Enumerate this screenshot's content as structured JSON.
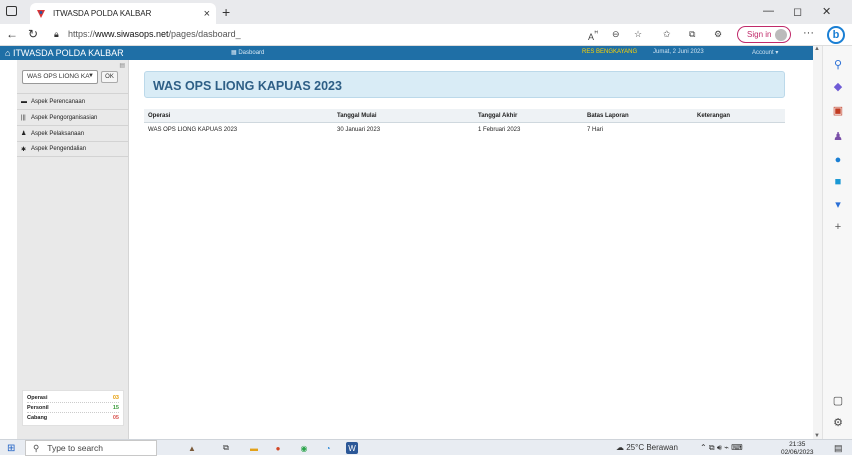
{
  "browser": {
    "tab_title": "ITWASDA POLDA KALBAR",
    "tab_close": "×",
    "new_tab": "+",
    "url_prefix": "https://",
    "url_host": "www.siwasops.net",
    "url_path": "/pages/dasboard_",
    "sign_in": "Sign in",
    "more": "···",
    "win_min": "—",
    "win_max": "◻",
    "win_close": "✕"
  },
  "navbar": {
    "brand": "ITWASDA POLDA KALBAR",
    "dashboard": "Dasboard",
    "user": "RES BENGKAYANG",
    "date": "Jumat, 2 Juni 2023",
    "account": "Account"
  },
  "sidebar": {
    "select_value": "WAS OPS LIONG KA",
    "ok_label": "OK",
    "menu": [
      {
        "label": "Aspek Perencanaan",
        "icon": "briefcase-icon",
        "glyph": "▬"
      },
      {
        "label": "Aspek Pengorganisasian",
        "icon": "bars-icon",
        "glyph": "|||"
      },
      {
        "label": "Aspek Pelaksanaan",
        "icon": "user-icon",
        "glyph": "♟"
      },
      {
        "label": "Aspek Pengendalian",
        "icon": "gear-icon",
        "glyph": "✱"
      }
    ],
    "counts": [
      {
        "label": "Operasi",
        "value": "03"
      },
      {
        "label": "Personil",
        "value": "15"
      },
      {
        "label": "Cabang",
        "value": "05"
      }
    ]
  },
  "main": {
    "heading": "WAS OPS LIONG KAPUAS 2023",
    "columns": [
      "Operasi",
      "Tanggal Mulai",
      "Tanggal Akhir",
      "Batas Laporan",
      "Keterangan"
    ],
    "rows": [
      [
        "WAS OPS LIONG KAPUAS 2023",
        "30 Januari 2023",
        "1 Februari 2023",
        "7 Hari",
        ""
      ]
    ]
  },
  "taskbar": {
    "search_placeholder": "Type to search",
    "weather": "25°C  Berawan",
    "time": "21:35",
    "date": "02/06/2023"
  },
  "colors": {
    "navbar": "#1f6fa6",
    "panel": "#d9ecf6",
    "heading": "#2e5f86",
    "user_highlight": "#ffd400"
  }
}
